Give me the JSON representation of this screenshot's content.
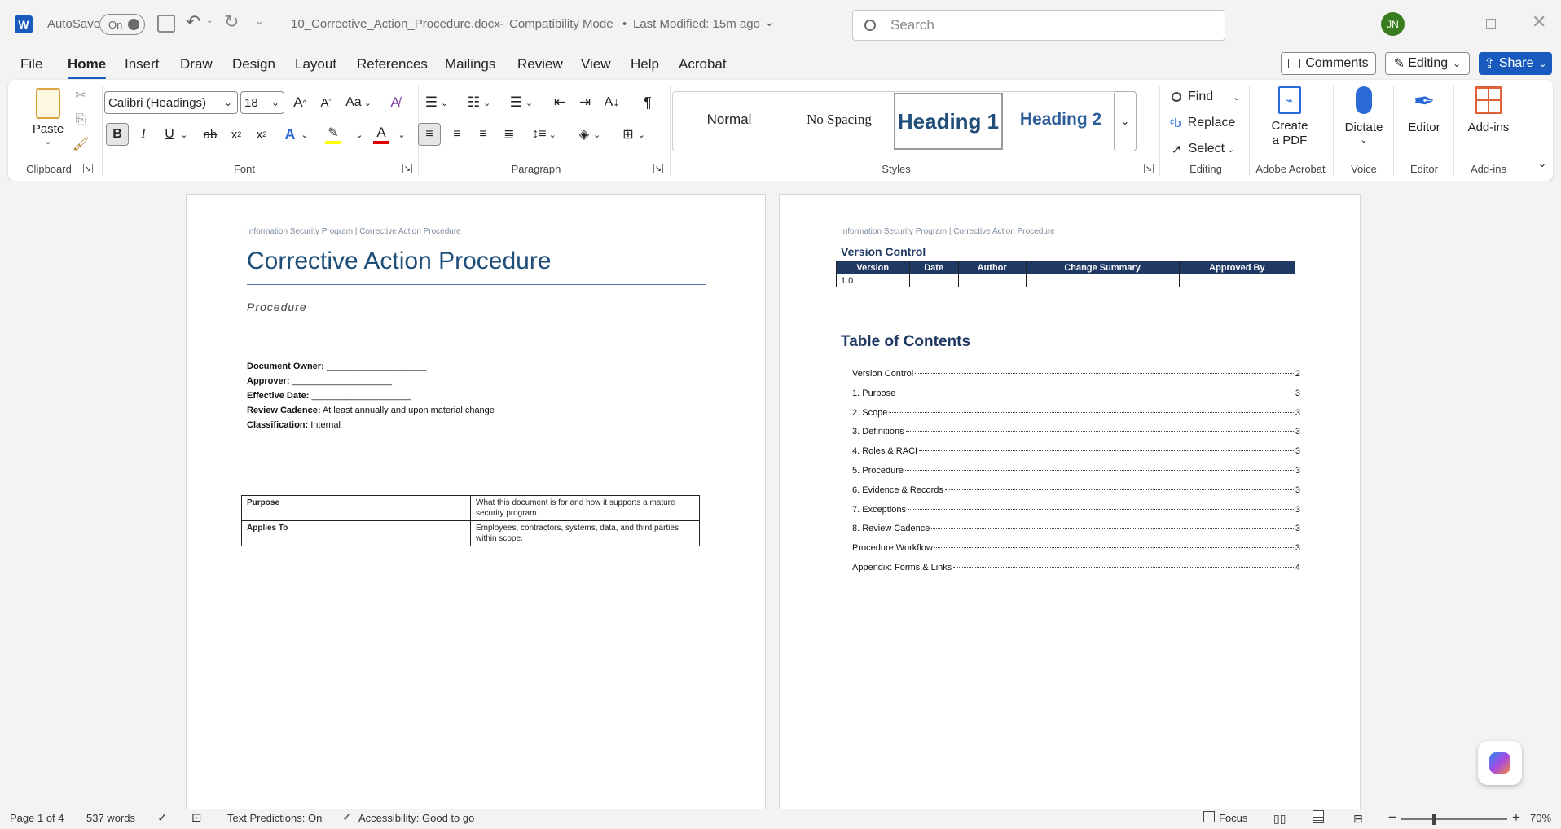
{
  "titlebar": {
    "autosave_label": "AutoSave",
    "autosave_state": "On",
    "document_title": "10_Corrective_Action_Procedure.docx",
    "mode": "Compatibility Mode",
    "last_modified": "Last Modified: 15m ago",
    "search_placeholder": "Search",
    "user_initials": "JN"
  },
  "menu": {
    "tabs": [
      "File",
      "Home",
      "Insert",
      "Draw",
      "Design",
      "Layout",
      "References",
      "Mailings",
      "Review",
      "View",
      "Help",
      "Acrobat"
    ],
    "active_tab": "Home",
    "comments_label": "Comments",
    "editing_label": "Editing",
    "share_label": "Share"
  },
  "ribbon": {
    "clipboard": {
      "paste_label": "Paste",
      "group_label": "Clipboard"
    },
    "font": {
      "font_name": "Calibri (Headings)",
      "font_size": "18",
      "group_label": "Font",
      "change_case": "Aa"
    },
    "paragraph": {
      "group_label": "Paragraph"
    },
    "styles": {
      "items": [
        "Normal",
        "No Spacing",
        "Heading 1",
        "Heading 2"
      ],
      "group_label": "Styles"
    },
    "editing": {
      "find_label": "Find",
      "replace_label": "Replace",
      "select_label": "Select",
      "group_label": "Editing"
    },
    "acrobat": {
      "create_pdf_line1": "Create",
      "create_pdf_line2": "a PDF",
      "group_label": "Adobe Acrobat"
    },
    "voice": {
      "dictate_label": "Dictate",
      "group_label": "Voice"
    },
    "editor": {
      "editor_label": "Editor",
      "group_label": "Editor"
    },
    "addins": {
      "addins_label": "Add-ins",
      "group_label": "Add-ins"
    },
    "colors": {
      "highlight": "#ffff00",
      "font_color": "#e00000",
      "accent": "#185abd"
    }
  },
  "page1": {
    "header": "Information Security Program | Corrective Action Procedure",
    "title": "Corrective Action Procedure",
    "subtitle": "Procedure",
    "meta": {
      "owner_label": "Document Owner:",
      "owner_value": "____________________",
      "approver_label": "Approver:",
      "approver_value": "____________________",
      "effective_label": "Effective Date:",
      "effective_value": "____________________",
      "cadence_label": "Review Cadence:",
      "cadence_value": "At least annually and upon material change",
      "class_label": "Classification:",
      "class_value": "Internal"
    },
    "table": [
      {
        "label": "Purpose",
        "value": "What this document is for and how it supports a mature security program."
      },
      {
        "label": "Applies To",
        "value": "Employees, contractors, systems, data, and third parties within scope."
      }
    ]
  },
  "page2": {
    "header": "Information Security Program | Corrective Action Procedure",
    "version_heading": "Version Control",
    "version_columns": [
      "Version",
      "Date",
      "Author",
      "Change Summary",
      "Approved By"
    ],
    "version_rows": [
      [
        "1.0",
        "",
        "",
        "",
        ""
      ]
    ],
    "toc_heading": "Table of Contents",
    "toc": [
      {
        "title": "Version Control",
        "page": "2"
      },
      {
        "title": "1. Purpose",
        "page": "3"
      },
      {
        "title": "2. Scope",
        "page": "3"
      },
      {
        "title": "3. Definitions",
        "page": "3"
      },
      {
        "title": "4. Roles & RACI",
        "page": "3"
      },
      {
        "title": "5. Procedure",
        "page": "3"
      },
      {
        "title": "6. Evidence & Records",
        "page": "3"
      },
      {
        "title": "7. Exceptions",
        "page": "3"
      },
      {
        "title": "8. Review Cadence",
        "page": "3"
      },
      {
        "title": "Procedure Workflow",
        "page": "3"
      },
      {
        "title": "Appendix: Forms & Links",
        "page": "4"
      }
    ]
  },
  "status": {
    "page": "Page 1 of 4",
    "words": "537 words",
    "text_predictions": "Text Predictions: On",
    "accessibility": "Accessibility: Good to go",
    "focus": "Focus",
    "zoom": "70%"
  }
}
